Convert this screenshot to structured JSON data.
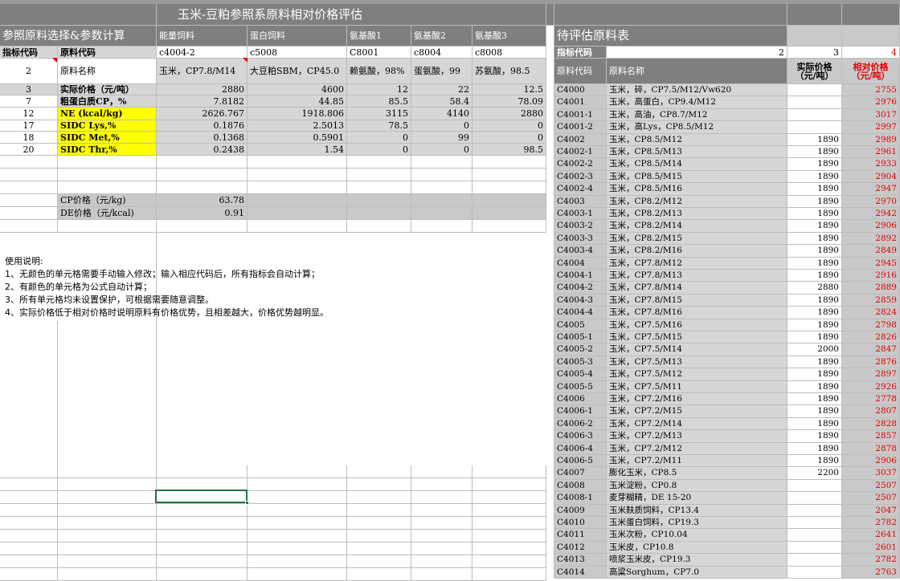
{
  "title": "玉米-豆粕参照系原料相对价格评估",
  "left": {
    "section_title": "参照原料选择&参数计算",
    "col_types": [
      "能量饲料",
      "蛋白饲料",
      "氨基酸1",
      "氨基酸2",
      "氨基酸3"
    ],
    "code_header": "指标代码",
    "name_header": "原料代码",
    "codes": [
      "c4004-2",
      "c5008",
      "C8001",
      "c8004",
      "c8008"
    ],
    "name_row": {
      "idx": "2",
      "label": "原料名称",
      "values": [
        "玉米，CP7.8/M14",
        "大豆粕SBM，CP45.0",
        "赖氨酸，98%",
        "蛋氨酸，99",
        "苏氨酸，98.5"
      ]
    },
    "price_row": {
      "idx": "3",
      "label": "实际价格（元/吨）",
      "values": [
        "2880",
        "4600",
        "12",
        "22",
        "12.5"
      ]
    },
    "params": [
      {
        "idx": "7",
        "label": "粗蛋白质CP，%",
        "values": [
          "7.8182",
          "44.85",
          "85.5",
          "58.4",
          "78.09"
        ]
      },
      {
        "idx": "12",
        "label": "NE (kcal/kg)",
        "values": [
          "2626.767",
          "1918.806",
          "3115",
          "4140",
          "2880"
        ]
      },
      {
        "idx": "17",
        "label": "SIDC Lys,%",
        "values": [
          "0.1876",
          "2.5013",
          "78.5",
          "0",
          "0"
        ]
      },
      {
        "idx": "18",
        "label": "SIDC Met,%",
        "values": [
          "0.1368",
          "0.5901",
          "0",
          "99",
          "0"
        ]
      },
      {
        "idx": "20",
        "label": "SIDC Thr,%",
        "values": [
          "0.2438",
          "1.54",
          "0",
          "0",
          "98.5"
        ]
      }
    ],
    "cp_price": {
      "label": "CP价格（元/kg)",
      "value": "63.78"
    },
    "de_price": {
      "label": "DE价格（元/kcal)",
      "value": "0.91"
    },
    "instructions": [
      "使用说明:",
      "1、无颜色的单元格需要手动输入修改；输入相应代码后，所有指标会自动计算；",
      "2、有颜色的单元格为公式自动计算；",
      "3、所有单元格均未设置保护，可根据需要随意调整。",
      "4、实际价格低于相对价格时说明原料有价格优势，且相差越大，价格优势越明显。"
    ]
  },
  "right": {
    "section_title": "待评估原料表",
    "code_header": "指标代码",
    "col_nums": [
      "2",
      "3",
      "4"
    ],
    "header_code": "原料代码",
    "header_name": "原料名称",
    "header_price": "实际价格（元/吨）",
    "header_rel": "相对价格（元/吨）",
    "rows": [
      {
        "code": "C4000",
        "name": "玉米，碎，CP7.5/M12/Vw620",
        "price": "",
        "rel": "2755"
      },
      {
        "code": "C4001",
        "name": "玉米，高蛋白，CP9.4/M12",
        "price": "",
        "rel": "2976"
      },
      {
        "code": "C4001-1",
        "name": "玉米，高油，CP8.7/M12",
        "price": "",
        "rel": "3017"
      },
      {
        "code": "C4001-2",
        "name": "玉米，高Lys，CP8.5/M12",
        "price": "",
        "rel": "2997"
      },
      {
        "code": "C4002",
        "name": "玉米，CP8.5/M12",
        "price": "1890",
        "rel": "2989"
      },
      {
        "code": "C4002-1",
        "name": "玉米，CP8.5/M13",
        "price": "1890",
        "rel": "2961"
      },
      {
        "code": "C4002-2",
        "name": "玉米，CP8.5/M14",
        "price": "1890",
        "rel": "2933"
      },
      {
        "code": "C4002-3",
        "name": "玉米，CP8.5/M15",
        "price": "1890",
        "rel": "2904"
      },
      {
        "code": "C4002-4",
        "name": "玉米，CP8.5/M16",
        "price": "1890",
        "rel": "2947"
      },
      {
        "code": "C4003",
        "name": "玉米，CP8.2/M12",
        "price": "1890",
        "rel": "2970"
      },
      {
        "code": "C4003-1",
        "name": "玉米，CP8.2/M13",
        "price": "1890",
        "rel": "2942"
      },
      {
        "code": "C4003-2",
        "name": "玉米，CP8.2/M14",
        "price": "1890",
        "rel": "2906"
      },
      {
        "code": "C4003-3",
        "name": "玉米，CP8.2/M15",
        "price": "1890",
        "rel": "2892"
      },
      {
        "code": "C4003-4",
        "name": "玉米，CP8.2/M16",
        "price": "1890",
        "rel": "2849"
      },
      {
        "code": "C4004",
        "name": "玉米，CP7.8/M12",
        "price": "1890",
        "rel": "2945"
      },
      {
        "code": "C4004-1",
        "name": "玉米，CP7.8/M13",
        "price": "1890",
        "rel": "2916"
      },
      {
        "code": "C4004-2",
        "name": "玉米，CP7.8/M14",
        "price": "2880",
        "rel": "2889"
      },
      {
        "code": "C4004-3",
        "name": "玉米，CP7.8/M15",
        "price": "1890",
        "rel": "2859"
      },
      {
        "code": "C4004-4",
        "name": "玉米，CP7.8/M16",
        "price": "1890",
        "rel": "2824"
      },
      {
        "code": "C4005",
        "name": "玉米，CP7.5/M16",
        "price": "1890",
        "rel": "2798"
      },
      {
        "code": "C4005-1",
        "name": "玉米，CP7.5/M15",
        "price": "1890",
        "rel": "2826"
      },
      {
        "code": "C4005-2",
        "name": "玉米，CP7.5/M14",
        "price": "2000",
        "rel": "2847"
      },
      {
        "code": "C4005-3",
        "name": "玉米，CP7.5/M13",
        "price": "1890",
        "rel": "2876"
      },
      {
        "code": "C4005-4",
        "name": "玉米，CP7.5/M12",
        "price": "1890",
        "rel": "2897"
      },
      {
        "code": "C4005-5",
        "name": "玉米，CP7.5/M11",
        "price": "1890",
        "rel": "2926"
      },
      {
        "code": "C4006",
        "name": "玉米，CP7.2/M16",
        "price": "1890",
        "rel": "2778"
      },
      {
        "code": "C4006-1",
        "name": "玉米，CP7.2/M15",
        "price": "1890",
        "rel": "2807"
      },
      {
        "code": "C4006-2",
        "name": "玉米，CP7.2/M14",
        "price": "1890",
        "rel": "2828"
      },
      {
        "code": "C4006-3",
        "name": "玉米，CP7.2/M13",
        "price": "1890",
        "rel": "2857"
      },
      {
        "code": "C4006-4",
        "name": "玉米，CP7.2/M12",
        "price": "1890",
        "rel": "2878"
      },
      {
        "code": "C4006-5",
        "name": "玉米，CP7.2/M11",
        "price": "1890",
        "rel": "2906"
      },
      {
        "code": "C4007",
        "name": "膨化玉米，CP8.5",
        "price": "2200",
        "rel": "3037"
      },
      {
        "code": "C4008",
        "name": "玉米淀粉，CP0.8",
        "price": "",
        "rel": "2507"
      },
      {
        "code": "C4008-1",
        "name": "麦芽糊精，DE 15-20",
        "price": "",
        "rel": "2507"
      },
      {
        "code": "C4009",
        "name": "玉米麸质饲料，CP13.4",
        "price": "",
        "rel": "2047"
      },
      {
        "code": "C4010",
        "name": "玉米蛋白饲料，CP19.3",
        "price": "",
        "rel": "2782"
      },
      {
        "code": "C4011",
        "name": "玉米次粉，CP10.04",
        "price": "",
        "rel": "2641"
      },
      {
        "code": "C4012",
        "name": "玉米皮，CP10.8",
        "price": "",
        "rel": "2601"
      },
      {
        "code": "C4013",
        "name": "喷浆玉米皮，CP19.3",
        "price": "",
        "rel": "2782"
      },
      {
        "code": "C4014",
        "name": "高粱Sorghum，CP7.0",
        "price": "",
        "rel": "2763"
      }
    ]
  },
  "colors": {
    "header_dark": "#7f7f7f",
    "formula_gray": "#d6d6d6",
    "highlight_yellow": "#ffff00",
    "rel_price_red": "#e00000",
    "selection_green": "#217346"
  }
}
